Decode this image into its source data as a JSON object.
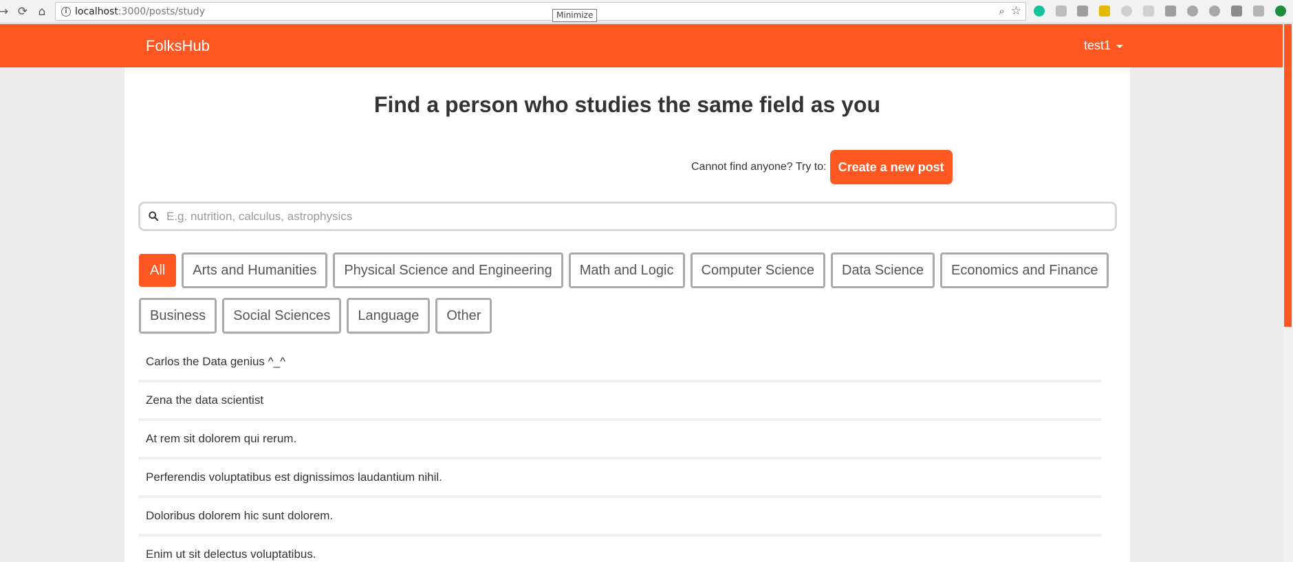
{
  "browser": {
    "url_host": "localhost",
    "url_path": ":3000/posts/study",
    "tooltip": "Minimize",
    "icons": [
      "back-icon",
      "reload-icon",
      "home-icon",
      "info-icon",
      "zoom-icon",
      "star-icon"
    ]
  },
  "header": {
    "brand": "FolksHub",
    "user": "test1"
  },
  "main": {
    "title": "Find a person who studies the same field as you",
    "cta_text": "Cannot find anyone? Try to:",
    "cta_button": "Create a new post",
    "search_placeholder": "E.g. nutrition, calculus, astrophysics",
    "filters_row1": [
      "All",
      "Arts and Humanities",
      "Physical Science and Engineering",
      "Math and Logic",
      "Computer Science",
      "Data Science",
      "Economics and Finance"
    ],
    "filters_row2": [
      "Business",
      "Social Sciences",
      "Language",
      "Other"
    ],
    "active_filter": "All",
    "posts": [
      "Carlos the Data genius ^_^",
      "Zena the data scientist",
      "At rem sit dolorem qui rerum.",
      "Perferendis voluptatibus est dignissimos laudantium nihil.",
      "Doloribus dolorem hic sunt dolorem.",
      "Enim ut sit delectus voluptatibus."
    ]
  },
  "colors": {
    "accent": "#ff5722",
    "page_bg": "#ececec"
  }
}
